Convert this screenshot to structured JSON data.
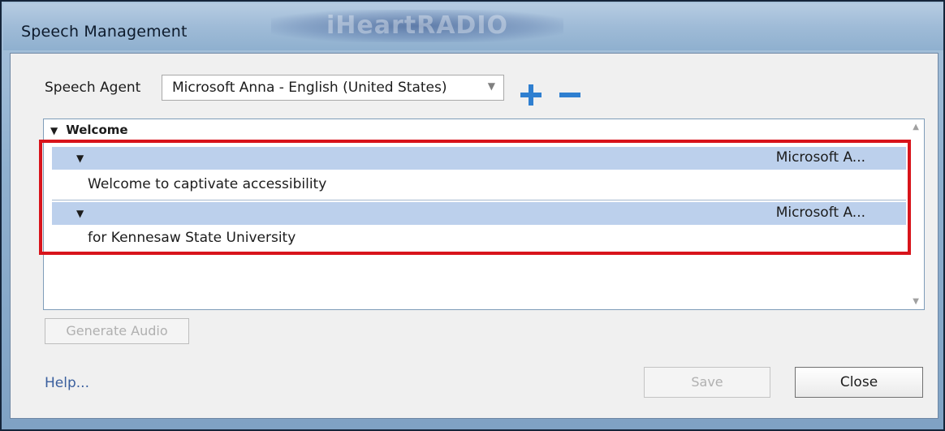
{
  "window": {
    "title": "Speech Management",
    "brand": "iHeartRADIO"
  },
  "agent": {
    "label": "Speech Agent",
    "selected": "Microsoft Anna - English (United States)",
    "add_icon": "plus-icon",
    "remove_icon": "minus-icon"
  },
  "tree": {
    "group": "Welcome",
    "items": [
      {
        "agent": "Microsoft A...",
        "text": "Welcome to captivate accessibility"
      },
      {
        "agent": "Microsoft A...",
        "text": "for Kennesaw State University"
      }
    ]
  },
  "buttons": {
    "generate": "Generate Audio",
    "help": "Help...",
    "save": "Save",
    "close": "Close"
  },
  "colors": {
    "accent": "#2f7fd0",
    "highlight": "#d8141b",
    "row_header": "#bcd0ec"
  }
}
